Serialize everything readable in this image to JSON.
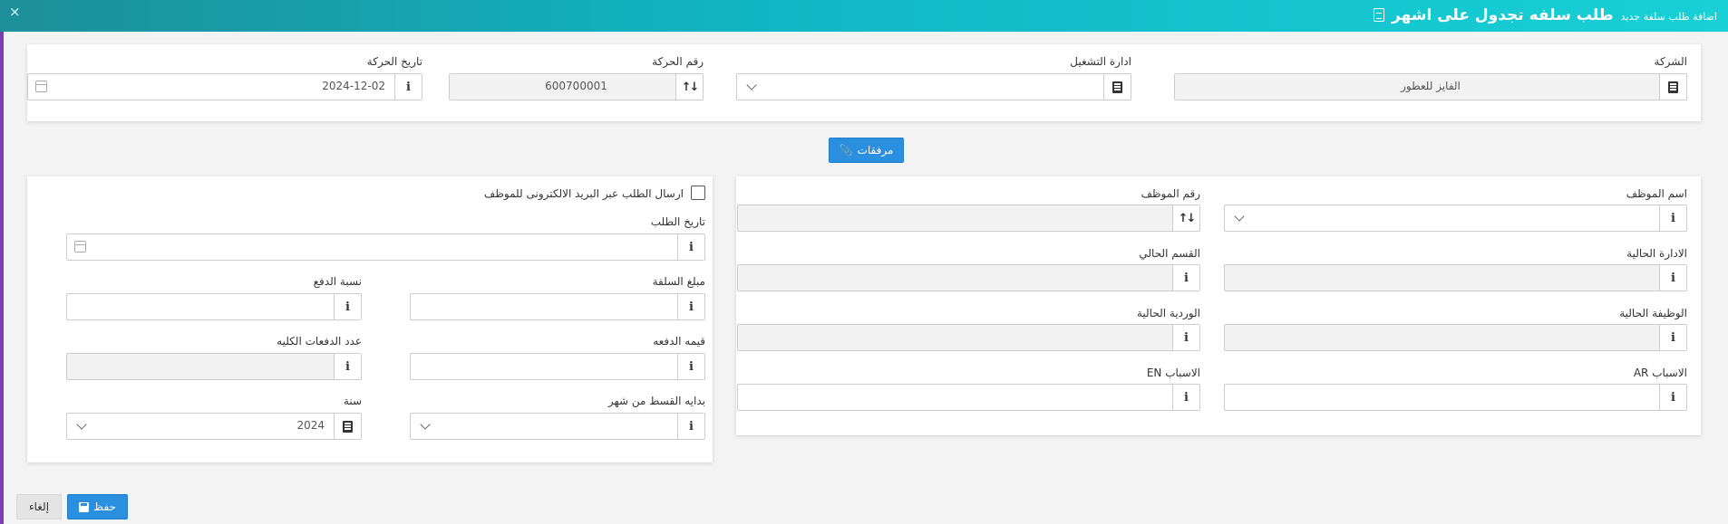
{
  "header": {
    "title": "طلب سلفه تجدول على اشهر",
    "subtitle": "اضافة طلب سلفة جديد",
    "close_icon": "×"
  },
  "top": {
    "company_label": "الشركة",
    "company_value": "الفايز للعطور",
    "operations_label": "ادارة التشغيل",
    "operations_value": "",
    "movement_no_label": "رقم الحركة",
    "movement_no_value": "600700001",
    "movement_date_label": "تاريخ الحركة",
    "movement_date_value": "2024-12-02"
  },
  "attachments_label": "مرفقات",
  "employee": {
    "name_label": "اسم الموظف",
    "number_label": "رقم الموظف",
    "current_dept_label": "الادارة الحالية",
    "current_section_label": "القسم الحالي",
    "current_job_label": "الوظيفة الحالية",
    "current_shift_label": "الوردية الحالية",
    "reasons_ar_label": "الاسباب AR",
    "reasons_en_label": "الاسباب EN"
  },
  "request": {
    "email_checkbox_label": "ارسال الطلب عبر البريد الالكترونى للموظف",
    "email_checked": false,
    "request_date_label": "تاريخ الطلب",
    "loan_amount_label": "مبلغ السلفة",
    "payment_ratio_label": "نسبة الدفع",
    "installment_value_label": "قيمه الدفعه",
    "total_payments_label": "عدد الدفعات الكليه",
    "start_month_label": "بدايه القسط من شهر",
    "year_label": "سنة",
    "year_value": "2024"
  },
  "footer": {
    "save_label": "حفظ",
    "cancel_label": "إلغاء"
  },
  "colors": {
    "header_start": "#1c8f9a",
    "header_end": "#18d0d6",
    "primary_button": "#2b8fe0",
    "left_strip": "#7b3fb3"
  }
}
